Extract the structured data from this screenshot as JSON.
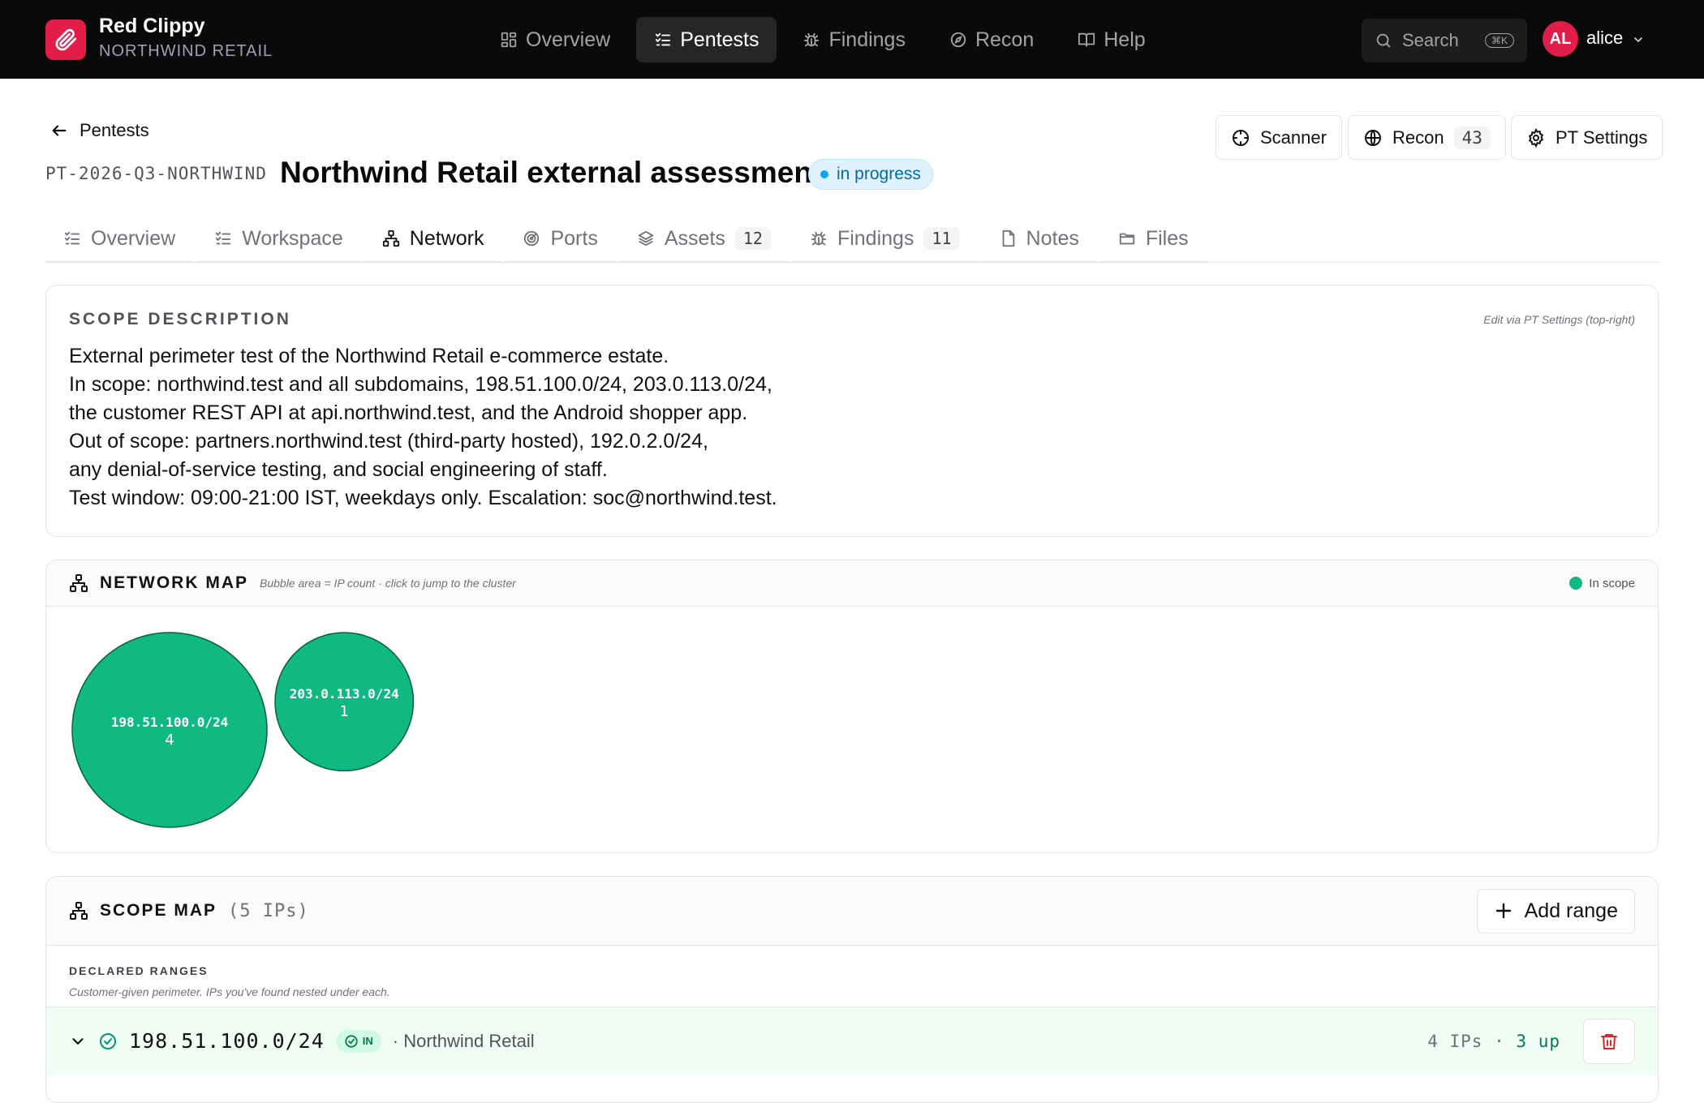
{
  "app": {
    "name": "Red Clippy",
    "org": "NORTHWIND RETAIL"
  },
  "nav": [
    {
      "label": "Overview",
      "icon": "grid-icon",
      "active": false
    },
    {
      "label": "Pentests",
      "icon": "checklist-icon",
      "active": true
    },
    {
      "label": "Findings",
      "icon": "bug-icon",
      "active": false
    },
    {
      "label": "Recon",
      "icon": "compass-icon",
      "active": false
    },
    {
      "label": "Help",
      "icon": "book-icon",
      "active": false
    }
  ],
  "search": {
    "placeholder": "Search",
    "shortcut": "⌘K"
  },
  "user": {
    "initials": "AL",
    "name": "alice"
  },
  "header": {
    "back_label": "Pentests",
    "id": "PT-2026-Q3-NORTHWIND",
    "separator": "·",
    "title": "Northwind Retail external assessment",
    "status": "in progress",
    "buttons": {
      "scanner": "Scanner",
      "recon": "Recon",
      "recon_count": "43",
      "settings": "PT Settings"
    }
  },
  "tabs": [
    {
      "label": "Overview",
      "icon": "checklist-icon",
      "count": ""
    },
    {
      "label": "Workspace",
      "icon": "checklist-icon",
      "count": ""
    },
    {
      "label": "Network",
      "icon": "network-icon",
      "count": "",
      "active": true
    },
    {
      "label": "Ports",
      "icon": "radar-icon",
      "count": ""
    },
    {
      "label": "Assets",
      "icon": "layers-icon",
      "count": "12"
    },
    {
      "label": "Findings",
      "icon": "bug-icon",
      "count": "11"
    },
    {
      "label": "Notes",
      "icon": "note-icon",
      "count": ""
    },
    {
      "label": "Files",
      "icon": "folder-icon",
      "count": ""
    }
  ],
  "scope_description": {
    "title": "SCOPE DESCRIPTION",
    "edit_hint": "Edit via PT Settings (top-right)",
    "lines": [
      "External perimeter test of the Northwind Retail e-commerce estate.",
      "In scope: northwind.test and all subdomains, 198.51.100.0/24, 203.0.113.0/24,",
      "the customer REST API at api.northwind.test, and the Android shopper app.",
      "Out of scope: partners.northwind.test (third-party hosted), 192.0.2.0/24,",
      "any denial-of-service testing, and social engineering of staff.",
      "Test window: 09:00-21:00 IST, weekdays only. Escalation: soc@northwind.test."
    ]
  },
  "network_map": {
    "title": "NETWORK MAP",
    "hint": "Bubble area = IP count · click to jump to the cluster",
    "legend": "In scope",
    "colors": {
      "in_scope": "#10b981",
      "stroke": "#065f46"
    },
    "bubbles": [
      {
        "cidr": "198.51.100.0/24",
        "count": 4
      },
      {
        "cidr": "203.0.113.0/24",
        "count": 1
      }
    ]
  },
  "scope_map": {
    "title": "SCOPE MAP",
    "ip_total": "(5 IPs)",
    "add_range": "Add range",
    "declared_label": "DECLARED RANGES",
    "declared_hint": "Customer-given perimeter. IPs you've found nested under each.",
    "ranges": [
      {
        "cidr": "198.51.100.0/24",
        "badge": "IN",
        "owner": "· Northwind Retail",
        "ips": "4 IPs",
        "sep": "·",
        "up": "3 up"
      }
    ]
  }
}
